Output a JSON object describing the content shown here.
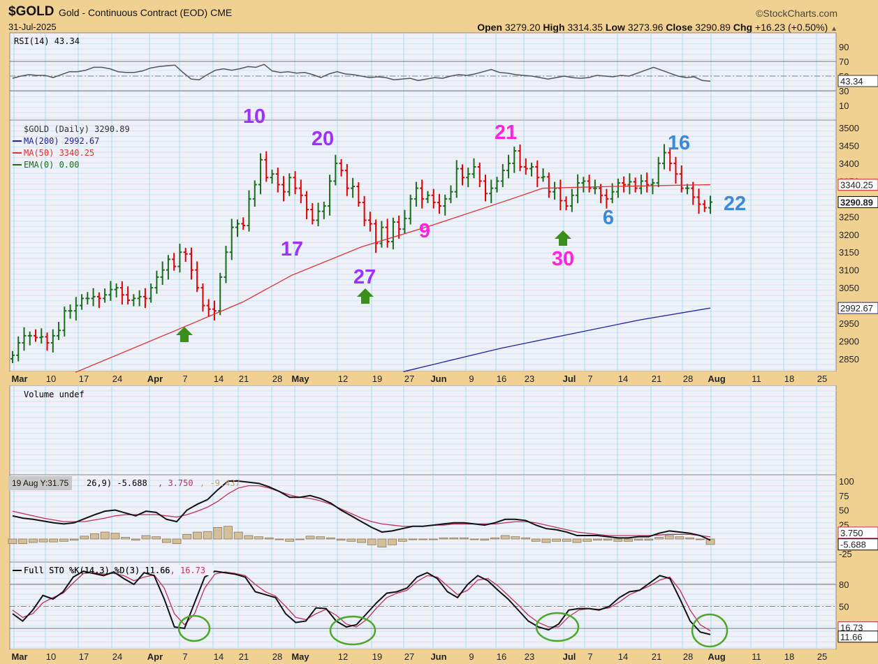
{
  "header": {
    "symbol": "$GOLD",
    "description": "Gold - Continuous Contract (EOD)",
    "exchange": "CME",
    "date": "31-Jul-2025",
    "brand": "©StockCharts.com",
    "open_label": "Open",
    "open": "3279.20",
    "high_label": "High",
    "high": "3314.35",
    "low_label": "Low",
    "low": "3273.96",
    "close_label": "Close",
    "close": "3290.89",
    "chg_label": "Chg",
    "chg": "+16.23 (+0.50%)",
    "chg_arrow": "▲"
  },
  "tooltip": "19 Aug Y:31.75",
  "colors": {
    "up": "#1a6b1a",
    "down": "#e00000",
    "ma50": "#e03030",
    "ma200": "#2020a0",
    "macd_signal": "#c0305a",
    "hist": "#d4bf9a",
    "circle": "#4aa82a",
    "arrow": "#3a8f1a"
  },
  "chart_data": [
    {
      "type": "line",
      "title": "RSI(14) 43.34",
      "legend": "RSI(14) 43.34",
      "ylim": [
        0,
        100
      ],
      "ticks": [
        "90",
        "70",
        "50",
        "30",
        "10"
      ],
      "last_tag": "43.34",
      "values": [
        47,
        50,
        52,
        51,
        51,
        48,
        52,
        56,
        56,
        58,
        62,
        62,
        60,
        56,
        55,
        55,
        57,
        61,
        63,
        64,
        65,
        55,
        46,
        45,
        52,
        58,
        60,
        58,
        60,
        63,
        62,
        66,
        57,
        55,
        56,
        54,
        55,
        52,
        48,
        53,
        56,
        53,
        52,
        50,
        48,
        49,
        48,
        45,
        46,
        47,
        44,
        46,
        48,
        47,
        50,
        52,
        51,
        53,
        56,
        59,
        55,
        54,
        52,
        51,
        50,
        48,
        46,
        48,
        50,
        48,
        47,
        48,
        51,
        50,
        49,
        51,
        50,
        54,
        58,
        62,
        58,
        54,
        50,
        48,
        49,
        44,
        43
      ]
    },
    {
      "type": "ohlc",
      "title": "$GOLD (Daily) 3290.89",
      "legend": [
        "$GOLD (Daily) 3290.89",
        "MA(200) 2992.67",
        "MA(50) 3340.25",
        "EMA(0) 0.00"
      ],
      "ylim": [
        2830,
        3520
      ],
      "ticks": [
        "3500",
        "3450",
        "3400",
        "3350",
        "3300",
        "3250",
        "3200",
        "3150",
        "3100",
        "3050",
        "3000",
        "2950",
        "2900",
        "2850"
      ],
      "tags": {
        "ma50": "3340.25",
        "close": "3290.89",
        "ma200": "2992.67"
      },
      "x_labels": [
        "Mar",
        "10",
        "17",
        "24",
        "Apr",
        "7",
        "14",
        "21",
        "28",
        "May",
        "12",
        "19",
        "27",
        "Jun",
        "9",
        "16",
        "23",
        "Jul",
        "7",
        "14",
        "21",
        "28",
        "Aug",
        "11",
        "18",
        "25"
      ],
      "closes": [
        2860,
        2895,
        2915,
        2915,
        2910,
        2912,
        2895,
        2915,
        2930,
        2985,
        2985,
        3000,
        3020,
        3020,
        3025,
        3020,
        3030,
        3045,
        3050,
        3030,
        3015,
        3020,
        3025,
        3020,
        3050,
        3080,
        3100,
        3130,
        3110,
        3150,
        3145,
        3100,
        3050,
        3000,
        2990,
        2985,
        3080,
        3150,
        3220,
        3230,
        3225,
        3300,
        3340,
        3410,
        3360,
        3370,
        3340,
        3320,
        3360,
        3330,
        3310,
        3270,
        3240,
        3265,
        3280,
        3350,
        3400,
        3380,
        3330,
        3335,
        3290,
        3240,
        3230,
        3175,
        3220,
        3180,
        3235,
        3215,
        3245,
        3300,
        3330,
        3300,
        3310,
        3290,
        3280,
        3300,
        3320,
        3385,
        3360,
        3370,
        3390,
        3350,
        3315,
        3330,
        3350,
        3380,
        3400,
        3435,
        3390,
        3385,
        3390,
        3360,
        3362,
        3320,
        3330,
        3295,
        3280,
        3310,
        3345,
        3350,
        3330,
        3330,
        3310,
        3300,
        3320,
        3345,
        3340,
        3348,
        3330,
        3350,
        3340,
        3345,
        3400,
        3430,
        3400,
        3370,
        3330,
        3330,
        3305,
        3285,
        3275,
        3291
      ],
      "ma50": [
        [
          0.09,
          2812
        ],
        [
          0.24,
          2935
        ],
        [
          0.33,
          3010
        ],
        [
          0.4,
          3085
        ],
        [
          0.5,
          3165
        ],
        [
          0.6,
          3225
        ],
        [
          0.7,
          3290
        ],
        [
          0.76,
          3330
        ],
        [
          0.86,
          3335
        ],
        [
          1,
          3340
        ]
      ],
      "ma200": [
        [
          0.56,
          2814
        ],
        [
          0.7,
          2880
        ],
        [
          0.8,
          2920
        ],
        [
          0.9,
          2960
        ],
        [
          1,
          2993
        ]
      ],
      "annotations": [
        {
          "text": "10",
          "color": "#9b30ff"
        },
        {
          "text": "20",
          "color": "#9b30ff"
        },
        {
          "text": "17",
          "color": "#9b30ff"
        },
        {
          "text": "27",
          "color": "#9b30ff"
        },
        {
          "text": "9",
          "color": "#ff20e0"
        },
        {
          "text": "21",
          "color": "#ff20e0"
        },
        {
          "text": "30",
          "color": "#ff20e0"
        },
        {
          "text": "6",
          "color": "#3a8ad8"
        },
        {
          "text": "16",
          "color": "#3a8ad8"
        },
        {
          "text": "22",
          "color": "#3a8ad8"
        }
      ]
    },
    {
      "type": "bar",
      "title": "Volume undef",
      "legend": "Volume undef"
    },
    {
      "type": "line",
      "title": "MACD",
      "legend": "26,9) -5.688, 3.750, -9.437",
      "legend_parts": [
        "26,9) -5.688",
        ", 3.750",
        ", -9.437"
      ],
      "ylim": [
        -30,
        105
      ],
      "ticks": [
        "100",
        "75",
        "50",
        "25",
        "-25"
      ],
      "tags": {
        "signal": "3.750",
        "macd": "-5.688"
      },
      "macd": [
        40,
        36,
        34,
        31,
        28,
        26,
        28,
        35,
        42,
        48,
        50,
        45,
        40,
        48,
        46,
        34,
        30,
        50,
        60,
        68,
        85,
        100,
        100,
        98,
        96,
        90,
        82,
        72,
        72,
        75,
        70,
        62,
        50,
        40,
        30,
        20,
        12,
        14,
        18,
        22,
        22,
        24,
        26,
        28,
        28,
        26,
        24,
        28,
        34,
        34,
        32,
        24,
        18,
        16,
        12,
        6,
        6,
        6,
        4,
        2,
        2,
        4,
        4,
        10,
        14,
        12,
        10,
        6,
        -2
      ],
      "signal": [
        48,
        44,
        40,
        36,
        33,
        30,
        30,
        30,
        33,
        36,
        40,
        42,
        42,
        42,
        42,
        40,
        38,
        42,
        48,
        55,
        65,
        78,
        88,
        92,
        92,
        88,
        82,
        76,
        72,
        70,
        66,
        60,
        52,
        44,
        36,
        30,
        26,
        24,
        22,
        22,
        22,
        24,
        24,
        26,
        26,
        26,
        26,
        26,
        28,
        30,
        30,
        28,
        24,
        20,
        16,
        12,
        10,
        8,
        6,
        6,
        6,
        6,
        6,
        7,
        8,
        8,
        8,
        6,
        3.75
      ],
      "hist": [
        -8,
        -8,
        -6,
        -5,
        -5,
        -4,
        -2,
        5,
        9,
        12,
        10,
        3,
        -2,
        6,
        4,
        -6,
        -8,
        8,
        12,
        13,
        20,
        22,
        12,
        6,
        4,
        2,
        0,
        -4,
        0,
        5,
        4,
        2,
        -2,
        -4,
        -6,
        -10,
        -14,
        -10,
        -4,
        0,
        0,
        0,
        2,
        2,
        2,
        0,
        -2,
        2,
        6,
        4,
        2,
        -4,
        -6,
        -4,
        -4,
        -6,
        -4,
        -2,
        -2,
        -4,
        -4,
        -2,
        -2,
        3,
        6,
        4,
        2,
        0,
        -9.4
      ]
    },
    {
      "type": "line",
      "title": "Full STO %K(14,3) %D(3) 11.66, 16.73",
      "legend": [
        "Full STO %K(14,3) %D(3) 11.66",
        ", 16.73"
      ],
      "ylim": [
        0,
        100
      ],
      "ticks": [
        "80",
        "50"
      ],
      "tags": {
        "d": "16.73",
        "k": "11.66"
      },
      "k": [
        40,
        30,
        45,
        65,
        60,
        70,
        90,
        98,
        95,
        92,
        97,
        88,
        80,
        96,
        92,
        60,
        22,
        20,
        55,
        90,
        98,
        96,
        94,
        90,
        70,
        66,
        62,
        40,
        28,
        30,
        48,
        47,
        30,
        22,
        25,
        40,
        55,
        68,
        70,
        75,
        90,
        96,
        88,
        70,
        62,
        80,
        92,
        85,
        72,
        60,
        45,
        30,
        22,
        18,
        26,
        45,
        47,
        47,
        45,
        50,
        62,
        70,
        72,
        82,
        92,
        88,
        60,
        30,
        15,
        11.66
      ],
      "d": [
        45,
        35,
        40,
        55,
        62,
        68,
        82,
        95,
        96,
        94,
        95,
        92,
        85,
        90,
        93,
        75,
        40,
        25,
        40,
        75,
        94,
        97,
        95,
        92,
        80,
        70,
        64,
        50,
        35,
        32,
        40,
        46,
        38,
        26,
        22,
        32,
        48,
        62,
        68,
        72,
        84,
        92,
        90,
        78,
        66,
        72,
        86,
        88,
        78,
        65,
        52,
        38,
        28,
        22,
        22,
        36,
        45,
        47,
        46,
        48,
        56,
        66,
        72,
        78,
        86,
        90,
        72,
        45,
        25,
        16.73
      ],
      "circles": 4
    }
  ]
}
